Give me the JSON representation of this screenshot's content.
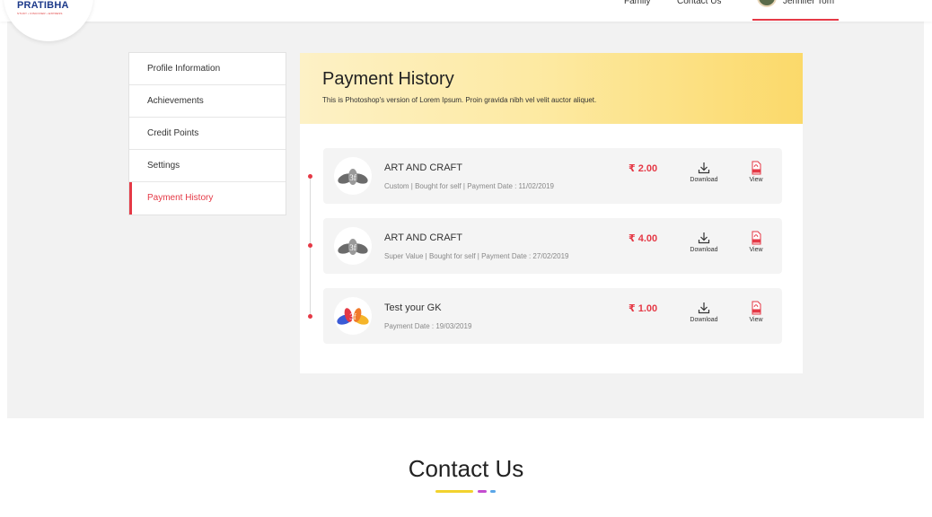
{
  "brand": {
    "name": "PRATIBHA",
    "tagline": "STUDY • DISCOVER • EXPRESS"
  },
  "nav": {
    "items": [
      "",
      "Family",
      "Contact Us",
      "Jennifer Tom"
    ]
  },
  "sidebar": {
    "items": [
      {
        "label": "Profile Information"
      },
      {
        "label": "Achievements"
      },
      {
        "label": "Credit Points"
      },
      {
        "label": "Settings"
      },
      {
        "label": "Payment History",
        "active": true
      }
    ]
  },
  "payment": {
    "title": "Payment History",
    "subtitle": "This is Photoshop's version  of Lorem Ipsum. Proin gravida nibh vel velit auctor aliquet.",
    "rows": [
      {
        "title": "ART AND CRAFT",
        "meta": "Custom  |  Bought for self  |  Payment Date : 11/02/2019",
        "amount": "₹ 2.00",
        "download": "Download",
        "view": "View",
        "thumb_icon": "lotus-grey-icon"
      },
      {
        "title": "ART AND CRAFT",
        "meta": "Super Value  |  Bought for self  |  Payment Date : 27/02/2019",
        "amount": "₹ 4.00",
        "download": "Download",
        "view": "View",
        "thumb_icon": "lotus-grey-icon"
      },
      {
        "title": "Test your GK",
        "meta": "Payment Date : 19/03/2019",
        "amount": "₹ 1.00",
        "download": "Download",
        "view": "View",
        "thumb_icon": "lotus-color-icon"
      }
    ]
  },
  "contact": {
    "title": "Contact Us"
  },
  "colors": {
    "accent": "#e53946",
    "bar_yellow": "#f2d22e",
    "bar_purple": "#c44dd0",
    "bar_blue": "#5aa6e8"
  }
}
